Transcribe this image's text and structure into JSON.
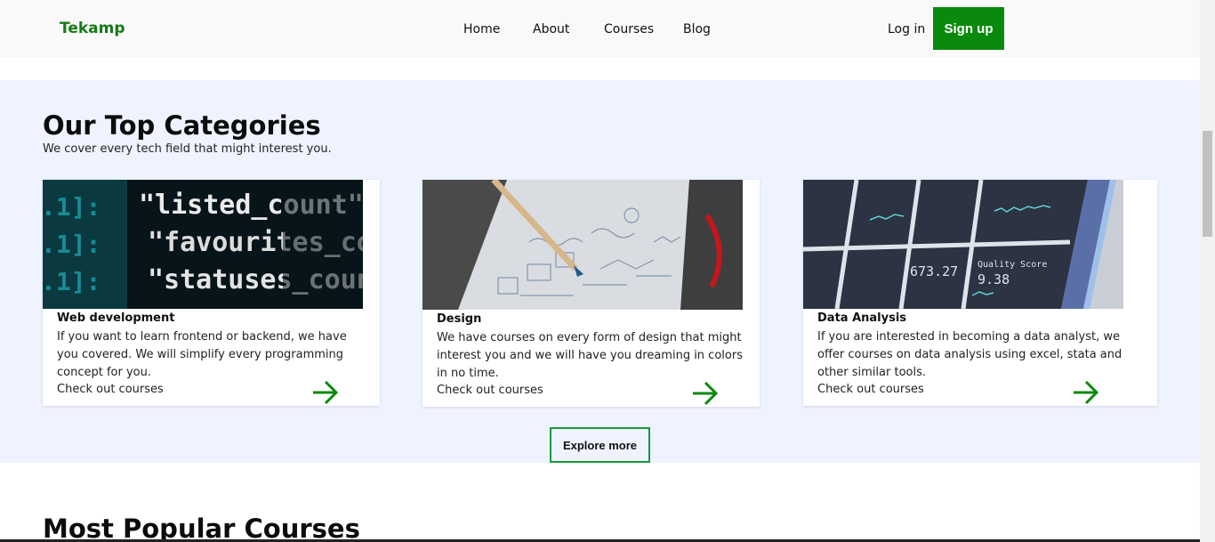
{
  "nav": {
    "brand": "Tekamp",
    "links": [
      "Home",
      "About",
      "Courses",
      "Blog"
    ],
    "login": "Log in",
    "signup": "Sign up"
  },
  "categories": {
    "title": "Our Top Categories",
    "subtitle": "We cover every tech field that might interest you.",
    "cards": [
      {
        "name": "Web development",
        "description": "If you want to learn frontend or backend, we have you covered. We will simplify every programming concept for you.",
        "link": "Check out courses",
        "image": {
          "lines": [
            "\"listed_count\":",
            "\"favourites_count\":",
            "\"statuses_count\":"
          ],
          "prefix": ".1]:"
        }
      },
      {
        "name": "Design",
        "description": "We have courses on every form of design that might interest you and we will have you dreaming in colors in no time.",
        "link": "Check out courses"
      },
      {
        "name": "Data Analysis",
        "description": "If you are interested in becoming a data analyst, we offer courses on data analysis using excel, stata and other similar tools.",
        "link": "Check out courses",
        "image": {
          "quality_label": "Quality Score",
          "quality_value": "9.38",
          "metric_value": "673.27"
        }
      }
    ],
    "explore": "Explore more"
  },
  "popular": {
    "title": "Most Popular Courses"
  },
  "colors": {
    "brand": "#157a18",
    "signup_bg": "#0a8a0c",
    "section_bg": "#eef3ff",
    "explore_border": "#149b3c",
    "arrow": "#0a8a0c"
  }
}
